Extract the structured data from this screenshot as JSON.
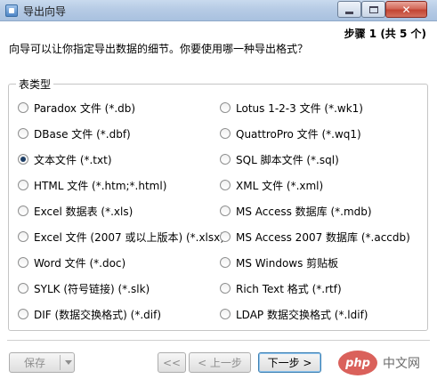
{
  "window": {
    "title": "导出向导",
    "close_glyph": "✕"
  },
  "header": {
    "step": "步骤 1 (共 5 个)",
    "prompt": "向导可以让你指定导出数据的细节。你要使用哪一种导出格式？"
  },
  "group": {
    "label": "表类型",
    "options": [
      {
        "label": "Paradox 文件 (*.db)",
        "checked": false
      },
      {
        "label": "Lotus 1-2-3 文件 (*.wk1)",
        "checked": false
      },
      {
        "label": "DBase 文件 (*.dbf)",
        "checked": false
      },
      {
        "label": "QuattroPro 文件 (*.wq1)",
        "checked": false
      },
      {
        "label": "文本文件 (*.txt)",
        "checked": true
      },
      {
        "label": "SQL 脚本文件 (*.sql)",
        "checked": false
      },
      {
        "label": "HTML 文件 (*.htm;*.html)",
        "checked": false
      },
      {
        "label": "XML 文件 (*.xml)",
        "checked": false
      },
      {
        "label": "Excel 数据表 (*.xls)",
        "checked": false
      },
      {
        "label": "MS Access 数据库 (*.mdb)",
        "checked": false
      },
      {
        "label": "Excel 文件 (2007 或以上版本) (*.xlsx)",
        "checked": false
      },
      {
        "label": "MS Access 2007 数据库 (*.accdb)",
        "checked": false
      },
      {
        "label": "Word 文件 (*.doc)",
        "checked": false
      },
      {
        "label": "MS Windows 剪贴板",
        "checked": false
      },
      {
        "label": "SYLK (符号链接) (*.slk)",
        "checked": false
      },
      {
        "label": "Rich Text 格式 (*.rtf)",
        "checked": false
      },
      {
        "label": "DIF (数据交换格式) (*.dif)",
        "checked": false
      },
      {
        "label": "LDAP 数据交换格式 (*.ldif)",
        "checked": false
      }
    ]
  },
  "footer": {
    "save": "保存",
    "first": "<<",
    "prev": "< 上一步",
    "next": "下一步 >"
  },
  "watermark": {
    "logo": "php",
    "text": "中文网"
  }
}
